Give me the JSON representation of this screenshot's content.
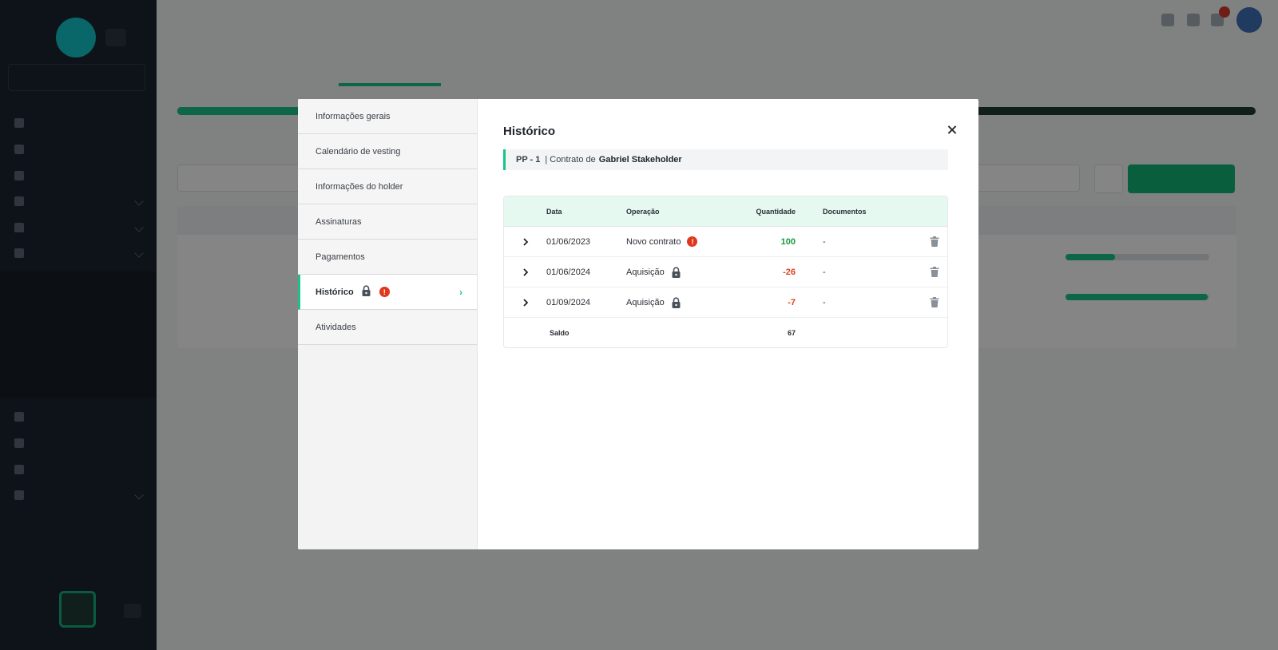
{
  "modal": {
    "nav": [
      {
        "label": "Informações gerais"
      },
      {
        "label": "Calendário de vesting"
      },
      {
        "label": "Informações do holder"
      },
      {
        "label": "Assinaturas"
      },
      {
        "label": "Pagamentos"
      },
      {
        "label": "Histórico",
        "active": true,
        "icons": [
          "lock-icon",
          "alert-icon",
          "chevron-right-icon"
        ]
      },
      {
        "label": "Atividades"
      }
    ],
    "title": "Histórico",
    "contract": {
      "code": "PP - 1",
      "prefix": "| Contrato de",
      "holder": "Gabriel Stakeholder"
    },
    "table": {
      "headers": {
        "date": "Data",
        "operation": "Operação",
        "quantity": "Quantidade",
        "documents": "Documentos"
      },
      "rows": [
        {
          "date": "01/06/2023",
          "operation": "Novo contrato",
          "status_icon": "alert-icon",
          "quantity": "100",
          "documents": "-"
        },
        {
          "date": "01/06/2024",
          "operation": "Aquisição",
          "status_icon": "lock-icon",
          "quantity": "-26",
          "documents": "-"
        },
        {
          "date": "01/09/2024",
          "operation": "Aquisição",
          "status_icon": "lock-icon",
          "quantity": "-7",
          "documents": "-"
        }
      ],
      "footer": {
        "label": "Saldo",
        "total": "67"
      }
    }
  },
  "colors": {
    "accent": "#18c38a",
    "positive": "#159a3c",
    "negative": "#e2401f",
    "alert": "#e0371c"
  }
}
